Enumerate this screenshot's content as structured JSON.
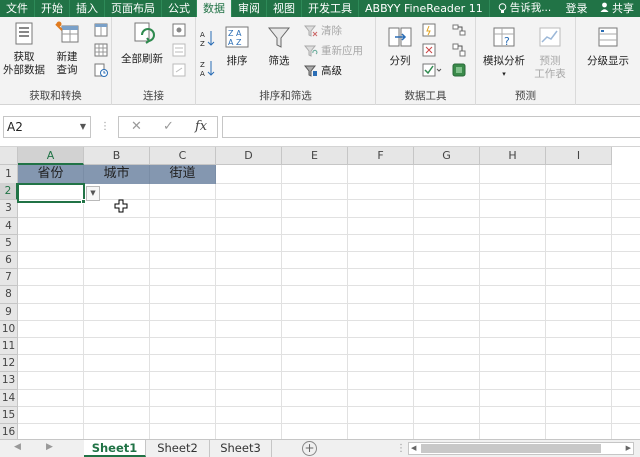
{
  "ribbon_tabs": [
    "文件",
    "开始",
    "插入",
    "页面布局",
    "公式",
    "数据",
    "审阅",
    "视图",
    "开发工具",
    "ABBYY FineReader 11"
  ],
  "active_tab_index": 5,
  "tell_me": "告诉我...",
  "login": "登录",
  "share": "共享",
  "groups": {
    "get_transform": {
      "label": "获取和转换",
      "get_external_line1": "获取",
      "get_external_line2": "外部数据",
      "new_query_line1": "新建",
      "new_query_line2": "查询"
    },
    "connections": {
      "label": "连接",
      "refresh_all": "全部刷新"
    },
    "sort_filter": {
      "label": "排序和筛选",
      "sort": "排序",
      "filter": "筛选",
      "clear": "清除",
      "reapply": "重新应用",
      "advanced": "高级"
    },
    "data_tools": {
      "label": "数据工具",
      "text_to_columns": "分列"
    },
    "forecast": {
      "label": "预测",
      "what_if": "模拟分析",
      "forecast_sheet_line1": "预测",
      "forecast_sheet_line2": "工作表"
    },
    "outline": {
      "label": "分级显示"
    }
  },
  "name_box": "A2",
  "columns": [
    "A",
    "B",
    "C",
    "D",
    "E",
    "F",
    "G",
    "H",
    "I"
  ],
  "rows": [
    "1",
    "2",
    "3",
    "4",
    "5",
    "6",
    "7",
    "8",
    "9",
    "10",
    "11",
    "12",
    "13",
    "14",
    "15",
    "16"
  ],
  "header_cells": [
    "省份",
    "城市",
    "街道"
  ],
  "sheets": [
    "Sheet1",
    "Sheet2",
    "Sheet3"
  ],
  "active_sheet_index": 0,
  "colors": {
    "excel_green": "#217346",
    "header_fill": "#8497b0"
  }
}
